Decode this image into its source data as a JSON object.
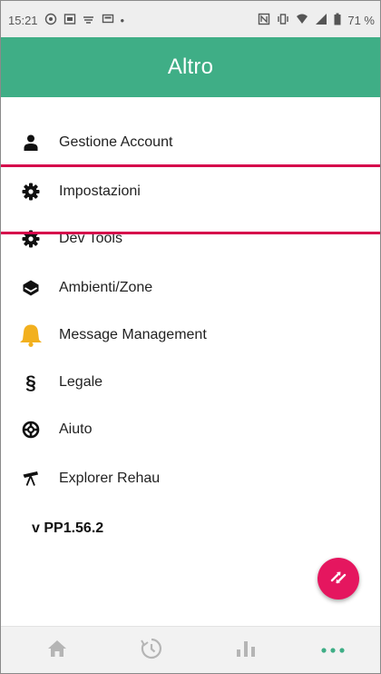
{
  "status_bar": {
    "time": "15:21",
    "battery": "71 %",
    "left_icons": [
      "whatsapp-icon",
      "gallery-icon",
      "wifi-icon",
      "screen-icon",
      "dot-icon"
    ],
    "right_icons": [
      "nfc-icon",
      "vibrate-icon",
      "wifi-signal-icon",
      "cell-signal-icon",
      "battery-icon"
    ]
  },
  "app_bar": {
    "title": "Altro"
  },
  "menu": {
    "items": [
      {
        "label": "Gestione Account",
        "icon": "person-icon"
      },
      {
        "label": "Impostazioni",
        "icon": "gear-icon"
      },
      {
        "label": "Dev Tools",
        "icon": "gear-icon"
      },
      {
        "label": "Ambienti/Zone",
        "icon": "cube-icon"
      },
      {
        "label": "Message Management",
        "icon": "bell-icon"
      },
      {
        "label": "Legale",
        "icon": "section-icon"
      },
      {
        "label": "Aiuto",
        "icon": "lifebuoy-icon"
      },
      {
        "label": "Explorer Rehau",
        "icon": "telescope-icon"
      }
    ]
  },
  "version": "v PP1.56.2",
  "fab": {
    "icon": "swap-arrows-icon",
    "color": "#e5165f"
  },
  "bottom_nav": {
    "items": [
      {
        "icon": "home-icon",
        "active": false
      },
      {
        "icon": "history-icon",
        "active": false
      },
      {
        "icon": "chart-icon",
        "active": false
      },
      {
        "icon": "more-icon",
        "active": true
      }
    ]
  },
  "colors": {
    "app_bar": "#3fae86",
    "accent_green": "#3fae86",
    "annotation_red": "#d6004b",
    "bell": "#f2b01e"
  }
}
